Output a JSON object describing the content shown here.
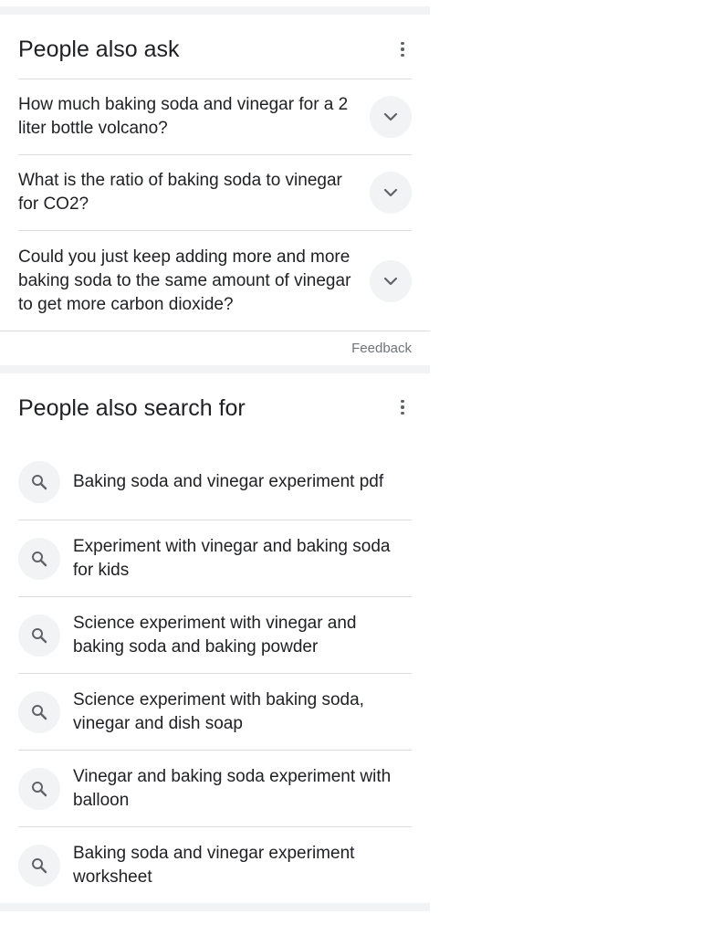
{
  "people_also_ask": {
    "title": "People also ask",
    "menu_icon": "more-vert-icon",
    "questions": [
      {
        "text": "How much baking soda and vinegar for a 2 liter bottle volcano?",
        "icon": "chevron-down-icon"
      },
      {
        "text": "What is the ratio of baking soda to vinegar for CO2?",
        "icon": "chevron-down-icon"
      },
      {
        "text": "Could you just keep adding more and more baking soda to the same amount of vinegar to get more carbon dioxide?",
        "icon": "chevron-down-icon"
      }
    ],
    "feedback_label": "Feedback"
  },
  "people_also_search_for": {
    "title": "People also search for",
    "menu_icon": "more-vert-icon",
    "items": [
      {
        "text": "Baking soda and vinegar experiment pdf",
        "icon": "search-icon"
      },
      {
        "text": "Experiment with vinegar and baking soda for kids",
        "icon": "search-icon"
      },
      {
        "text": "Science experiment with vinegar and baking soda and baking powder",
        "icon": "search-icon"
      },
      {
        "text": "Science experiment with baking soda, vinegar and dish soap",
        "icon": "search-icon"
      },
      {
        "text": "Vinegar and baking soda experiment with balloon",
        "icon": "search-icon"
      },
      {
        "text": "Baking soda and vinegar experiment worksheet",
        "icon": "search-icon"
      }
    ]
  },
  "colors": {
    "text": "#202124",
    "secondary_text": "#70757a",
    "icon": "#5f6368",
    "divider": "#dadce0",
    "section_gap": "#f1f3f4"
  }
}
